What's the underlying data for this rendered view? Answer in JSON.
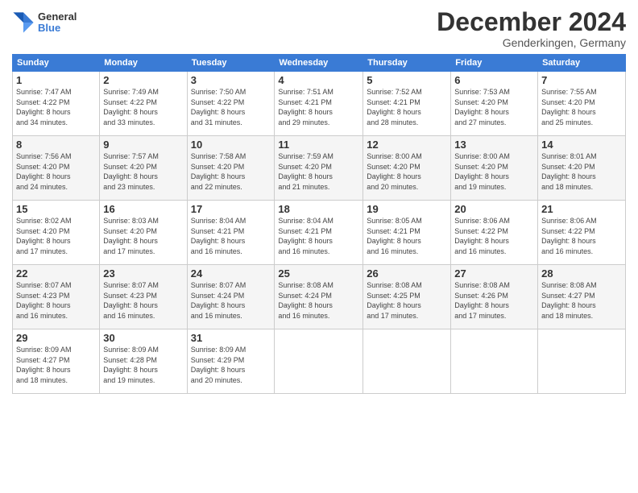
{
  "logo": {
    "general": "General",
    "blue": "Blue"
  },
  "title": "December 2024",
  "location": "Genderkingen, Germany",
  "days_header": [
    "Sunday",
    "Monday",
    "Tuesday",
    "Wednesday",
    "Thursday",
    "Friday",
    "Saturday"
  ],
  "weeks": [
    [
      {
        "day": "1",
        "sunrise": "7:47 AM",
        "sunset": "4:22 PM",
        "daylight": "8 hours and 34 minutes."
      },
      {
        "day": "2",
        "sunrise": "7:49 AM",
        "sunset": "4:22 PM",
        "daylight": "8 hours and 33 minutes."
      },
      {
        "day": "3",
        "sunrise": "7:50 AM",
        "sunset": "4:22 PM",
        "daylight": "8 hours and 31 minutes."
      },
      {
        "day": "4",
        "sunrise": "7:51 AM",
        "sunset": "4:21 PM",
        "daylight": "8 hours and 29 minutes."
      },
      {
        "day": "5",
        "sunrise": "7:52 AM",
        "sunset": "4:21 PM",
        "daylight": "8 hours and 28 minutes."
      },
      {
        "day": "6",
        "sunrise": "7:53 AM",
        "sunset": "4:20 PM",
        "daylight": "8 hours and 27 minutes."
      },
      {
        "day": "7",
        "sunrise": "7:55 AM",
        "sunset": "4:20 PM",
        "daylight": "8 hours and 25 minutes."
      }
    ],
    [
      {
        "day": "8",
        "sunrise": "7:56 AM",
        "sunset": "4:20 PM",
        "daylight": "8 hours and 24 minutes."
      },
      {
        "day": "9",
        "sunrise": "7:57 AM",
        "sunset": "4:20 PM",
        "daylight": "8 hours and 23 minutes."
      },
      {
        "day": "10",
        "sunrise": "7:58 AM",
        "sunset": "4:20 PM",
        "daylight": "8 hours and 22 minutes."
      },
      {
        "day": "11",
        "sunrise": "7:59 AM",
        "sunset": "4:20 PM",
        "daylight": "8 hours and 21 minutes."
      },
      {
        "day": "12",
        "sunrise": "8:00 AM",
        "sunset": "4:20 PM",
        "daylight": "8 hours and 20 minutes."
      },
      {
        "day": "13",
        "sunrise": "8:00 AM",
        "sunset": "4:20 PM",
        "daylight": "8 hours and 19 minutes."
      },
      {
        "day": "14",
        "sunrise": "8:01 AM",
        "sunset": "4:20 PM",
        "daylight": "8 hours and 18 minutes."
      }
    ],
    [
      {
        "day": "15",
        "sunrise": "8:02 AM",
        "sunset": "4:20 PM",
        "daylight": "8 hours and 17 minutes."
      },
      {
        "day": "16",
        "sunrise": "8:03 AM",
        "sunset": "4:20 PM",
        "daylight": "8 hours and 17 minutes."
      },
      {
        "day": "17",
        "sunrise": "8:04 AM",
        "sunset": "4:21 PM",
        "daylight": "8 hours and 16 minutes."
      },
      {
        "day": "18",
        "sunrise": "8:04 AM",
        "sunset": "4:21 PM",
        "daylight": "8 hours and 16 minutes."
      },
      {
        "day": "19",
        "sunrise": "8:05 AM",
        "sunset": "4:21 PM",
        "daylight": "8 hours and 16 minutes."
      },
      {
        "day": "20",
        "sunrise": "8:06 AM",
        "sunset": "4:22 PM",
        "daylight": "8 hours and 16 minutes."
      },
      {
        "day": "21",
        "sunrise": "8:06 AM",
        "sunset": "4:22 PM",
        "daylight": "8 hours and 16 minutes."
      }
    ],
    [
      {
        "day": "22",
        "sunrise": "8:07 AM",
        "sunset": "4:23 PM",
        "daylight": "8 hours and 16 minutes."
      },
      {
        "day": "23",
        "sunrise": "8:07 AM",
        "sunset": "4:23 PM",
        "daylight": "8 hours and 16 minutes."
      },
      {
        "day": "24",
        "sunrise": "8:07 AM",
        "sunset": "4:24 PM",
        "daylight": "8 hours and 16 minutes."
      },
      {
        "day": "25",
        "sunrise": "8:08 AM",
        "sunset": "4:24 PM",
        "daylight": "8 hours and 16 minutes."
      },
      {
        "day": "26",
        "sunrise": "8:08 AM",
        "sunset": "4:25 PM",
        "daylight": "8 hours and 17 minutes."
      },
      {
        "day": "27",
        "sunrise": "8:08 AM",
        "sunset": "4:26 PM",
        "daylight": "8 hours and 17 minutes."
      },
      {
        "day": "28",
        "sunrise": "8:08 AM",
        "sunset": "4:27 PM",
        "daylight": "8 hours and 18 minutes."
      }
    ],
    [
      {
        "day": "29",
        "sunrise": "8:09 AM",
        "sunset": "4:27 PM",
        "daylight": "8 hours and 18 minutes."
      },
      {
        "day": "30",
        "sunrise": "8:09 AM",
        "sunset": "4:28 PM",
        "daylight": "8 hours and 19 minutes."
      },
      {
        "day": "31",
        "sunrise": "8:09 AM",
        "sunset": "4:29 PM",
        "daylight": "8 hours and 20 minutes."
      },
      null,
      null,
      null,
      null
    ]
  ]
}
